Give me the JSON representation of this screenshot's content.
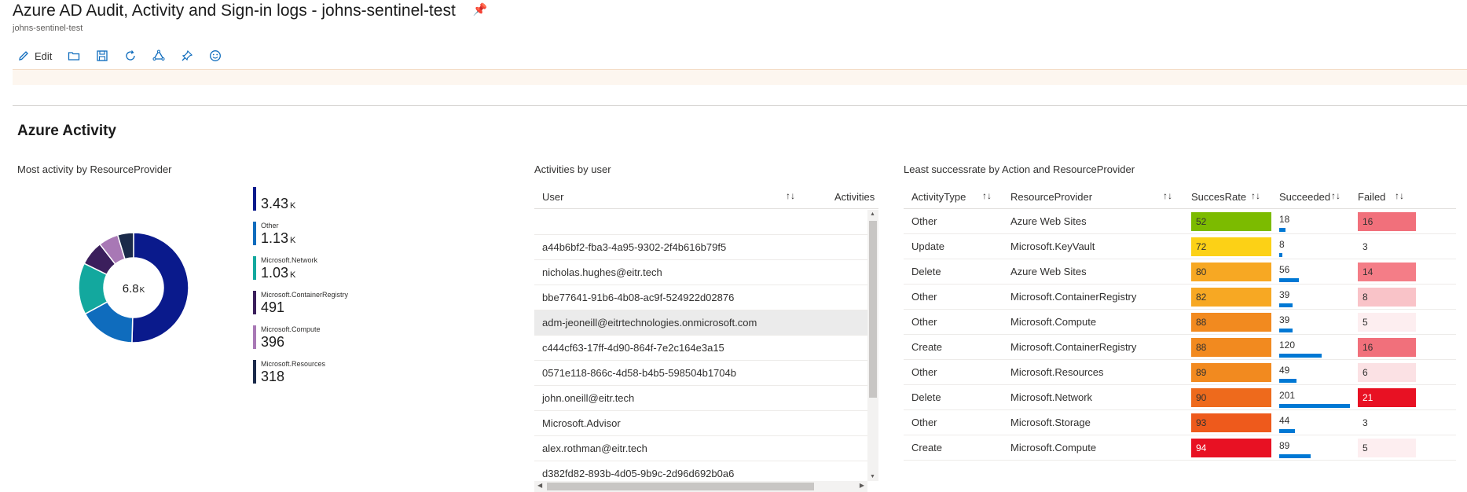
{
  "header": {
    "title": "Azure AD Audit, Activity and Sign-in logs - johns-sentinel-test",
    "subtitle": "johns-sentinel-test"
  },
  "toolbar": {
    "edit_label": "Edit",
    "buttons": [
      "pencil-icon",
      "folder-icon",
      "save-icon",
      "refresh-icon",
      "shared-icon",
      "pin-icon",
      "smiley-icon"
    ]
  },
  "section_title": "Azure Activity",
  "colors": {
    "accent": "#0078d4"
  },
  "resource_provider": {
    "title": "Most activity by ResourceProvider",
    "total": "6.8",
    "total_unit": "K",
    "legend": [
      {
        "name": "",
        "value": "3.43",
        "unit": "K",
        "color": "#0a1a8c"
      },
      {
        "name": "Other",
        "value": "1.13",
        "unit": "K",
        "color": "#0f6cbd"
      },
      {
        "name": "Microsoft.Network",
        "value": "1.03",
        "unit": "K",
        "color": "#13a89e"
      },
      {
        "name": "Microsoft.ContainerRegistry",
        "value": "491",
        "unit": "",
        "color": "#3b1f5c"
      },
      {
        "name": "Microsoft.Compute",
        "value": "396",
        "unit": "",
        "color": "#a878b5"
      },
      {
        "name": "Microsoft.Resources",
        "value": "318",
        "unit": "",
        "color": "#1b2a4a"
      }
    ],
    "slice_values": [
      3430,
      1130,
      1030,
      491,
      396,
      318
    ]
  },
  "activities_by_user": {
    "title": "Activities by user",
    "col_user": "User",
    "col_activities": "Activities",
    "rows": [
      "",
      "a44b6bf2-fba3-4a95-9302-2f4b616b79f5",
      "nicholas.hughes@eitr.tech",
      "bbe77641-91b6-4b08-ac9f-524922d02876",
      "adm-jeoneill@eitrtechnologies.onmicrosoft.com",
      "c444cf63-17ff-4d90-864f-7e2c164e3a15",
      "0571e118-866c-4d58-b4b5-598504b1704b",
      "john.oneill@eitr.tech",
      "Microsoft.Advisor",
      "alex.rothman@eitr.tech",
      "d382fd82-893b-4d05-9b9c-2d96d692b0a6"
    ],
    "selected_index": 4
  },
  "least_success": {
    "title": "Least successrate by Action and ResourceProvider",
    "headers": [
      "ActivityType",
      "ResourceProvider",
      "SuccesRate",
      "Succeeded",
      "Failed"
    ],
    "rows": [
      {
        "type": "Other",
        "provider": "Azure Web Sites",
        "rate": "52",
        "succeeded": "18",
        "failed": "16",
        "rate_color": "#7cbb00",
        "fail_color": "#f1707b"
      },
      {
        "type": "Update",
        "provider": "Microsoft.KeyVault",
        "rate": "72",
        "succeeded": "8",
        "failed": "3",
        "rate_color": "#fcd116",
        "fail_color": "#ffffff"
      },
      {
        "type": "Delete",
        "provider": "Azure Web Sites",
        "rate": "80",
        "succeeded": "56",
        "failed": "14",
        "rate_color": "#f7a823",
        "fail_color": "#f47d87"
      },
      {
        "type": "Other",
        "provider": "Microsoft.ContainerRegistry",
        "rate": "82",
        "succeeded": "39",
        "failed": "8",
        "rate_color": "#f7a823",
        "fail_color": "#f9c3c8"
      },
      {
        "type": "Other",
        "provider": "Microsoft.Compute",
        "rate": "88",
        "succeeded": "39",
        "failed": "5",
        "rate_color": "#f28a1f",
        "fail_color": "#fdeef0"
      },
      {
        "type": "Create",
        "provider": "Microsoft.ContainerRegistry",
        "rate": "88",
        "succeeded": "120",
        "failed": "16",
        "rate_color": "#f28a1f",
        "fail_color": "#f1707b"
      },
      {
        "type": "Other",
        "provider": "Microsoft.Resources",
        "rate": "89",
        "succeeded": "49",
        "failed": "6",
        "rate_color": "#f28a1f",
        "fail_color": "#fbe1e4"
      },
      {
        "type": "Delete",
        "provider": "Microsoft.Network",
        "rate": "90",
        "succeeded": "201",
        "failed": "21",
        "rate_color": "#ee6a1c",
        "fail_color": "#e81123"
      },
      {
        "type": "Other",
        "provider": "Microsoft.Storage",
        "rate": "93",
        "succeeded": "44",
        "failed": "3",
        "rate_color": "#ee5a1c",
        "fail_color": "#ffffff"
      },
      {
        "type": "Create",
        "provider": "Microsoft.Compute",
        "rate": "94",
        "succeeded": "89",
        "failed": "5",
        "rate_color": "#e81123",
        "fail_color": "#fdeef0"
      }
    ],
    "succeeded_max": 201
  }
}
